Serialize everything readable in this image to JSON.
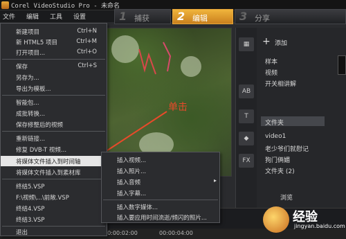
{
  "window": {
    "title": "Corel VideoStudio Pro - 未命名"
  },
  "menubar": {
    "items": [
      "文件",
      "编辑",
      "工具",
      "设置"
    ]
  },
  "steps": [
    {
      "num": "1",
      "label": "捕获"
    },
    {
      "num": "2",
      "label": "编辑"
    },
    {
      "num": "3",
      "label": "分享"
    }
  ],
  "preview": {
    "overlay_text": "单击"
  },
  "library": {
    "add_label": "添加",
    "items": [
      "样本",
      "视频",
      "开关相讲解",
      "文件夹",
      "video1",
      "老少爷们就慰记",
      "狗门俩媚",
      "文件夹 (2)"
    ],
    "selected_index": 3,
    "side_icons": [
      "media-icon",
      "transition-icon",
      "title-icon",
      "graphic-icon",
      "filter-icon"
    ],
    "side_icon_glyphs": [
      "▦",
      "AB",
      "T",
      "◆",
      "FX"
    ],
    "bottom_label": "浏览"
  },
  "file_menu": {
    "items": [
      {
        "label": "新建项目",
        "shortcut": "Ctrl+N"
      },
      {
        "label": "新 HTML5 项目",
        "shortcut": "Ctrl+M"
      },
      {
        "label": "打开项目...",
        "shortcut": "Ctrl+O"
      },
      {
        "label": "保存",
        "shortcut": "Ctrl+S"
      },
      {
        "label": "另存为...",
        "shortcut": ""
      },
      {
        "label": "导出为模板...",
        "shortcut": ""
      },
      {
        "label": "智能包...",
        "shortcut": ""
      },
      {
        "label": "成批转换...",
        "shortcut": ""
      },
      {
        "label": "保存修整后的视频",
        "shortcut": ""
      },
      {
        "label": "重新链接...",
        "shortcut": ""
      },
      {
        "label": "修复 DVB-T 视频...",
        "shortcut": ""
      },
      {
        "label": "将媒体文件插入到时间轴",
        "shortcut": "",
        "submenu": true
      },
      {
        "label": "将媒体文件插入到素材库",
        "shortcut": "",
        "submenu": true
      },
      {
        "label": "终结5.VSP",
        "shortcut": ""
      },
      {
        "label": "F:\\视频\\...\\前敞.VSP",
        "shortcut": ""
      },
      {
        "label": "终结4.VSP",
        "shortcut": ""
      },
      {
        "label": "终结3.VSP",
        "shortcut": ""
      },
      {
        "label": "退出",
        "shortcut": ""
      }
    ]
  },
  "sub_menu": {
    "items": [
      {
        "label": "插入视频...",
        "submenu": false
      },
      {
        "label": "插入照片...",
        "submenu": false
      },
      {
        "label": "插入音频",
        "submenu": true
      },
      {
        "label": "插入字幕...",
        "submenu": false
      },
      {
        "label": "插入数字媒体...",
        "submenu": false
      },
      {
        "label": "插入要应用时间流逝/频闪的照片...",
        "submenu": false
      }
    ]
  },
  "timeline": {
    "ticks": [
      "00:00:02:00",
      "00:00:04:00"
    ]
  },
  "watermark": {
    "text": "经验",
    "sub": "jingyan.baidu.com"
  }
}
